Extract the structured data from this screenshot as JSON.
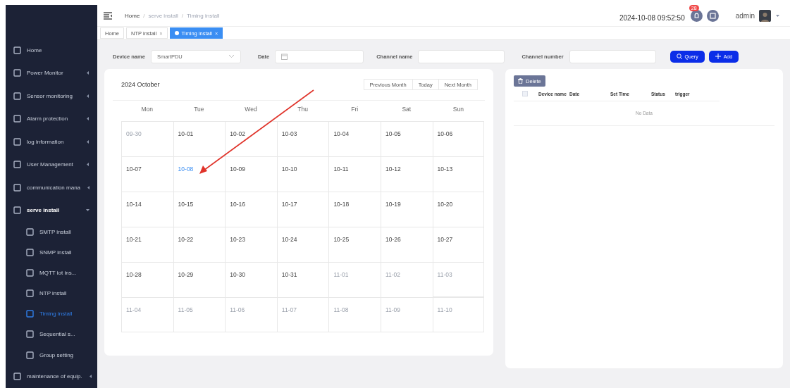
{
  "sidebar": {
    "items": [
      {
        "label": "Home",
        "expandable": false,
        "expanded": false
      },
      {
        "label": "Power Monitor",
        "expandable": true,
        "expanded": false
      },
      {
        "label": "Sensor monitoring",
        "expandable": true,
        "expanded": false
      },
      {
        "label": "Alarm protection",
        "expandable": true,
        "expanded": false
      },
      {
        "label": "log information",
        "expandable": true,
        "expanded": false
      },
      {
        "label": "User Management",
        "expandable": true,
        "expanded": false
      },
      {
        "label": "communication mana",
        "expandable": true,
        "expanded": false
      },
      {
        "label": "serve install",
        "expandable": true,
        "expanded": true,
        "children": [
          {
            "label": "SMTP install",
            "selected": false
          },
          {
            "label": "SNMP install",
            "selected": false
          },
          {
            "label": "MQTT iot ins...",
            "selected": false
          },
          {
            "label": "NTP install",
            "selected": false
          },
          {
            "label": "Timing install",
            "selected": true
          },
          {
            "label": "Sequential s...",
            "selected": false
          },
          {
            "label": "Group setting",
            "selected": false
          }
        ]
      },
      {
        "label": "maintenance of equip.",
        "expandable": true,
        "expanded": false
      }
    ]
  },
  "header": {
    "breadcrumb": [
      {
        "label": "Home"
      },
      {
        "separator": "/",
        "label": "serve install"
      },
      {
        "separator": "/",
        "label": "Timing install"
      }
    ],
    "datetime": "2024-10-08 09:52:50",
    "notification_count": "28",
    "user": "admin"
  },
  "tabs": [
    {
      "label": "Home",
      "selected": false
    },
    {
      "label": "NTP install",
      "selected": false,
      "close": "×"
    },
    {
      "label": "Timing install",
      "selected": true,
      "close": "×"
    }
  ],
  "filters": [
    {
      "label": "Device name",
      "kind": "select",
      "value": "SmartPDU"
    },
    {
      "label": "Date",
      "kind": "date"
    },
    {
      "label": "Channel name",
      "kind": "text"
    },
    {
      "label": "Channel number",
      "kind": "text"
    }
  ],
  "actions": [
    {
      "label": "Query",
      "kind": "search"
    },
    {
      "label": "Add",
      "kind": "add"
    }
  ],
  "calendar": {
    "title": "2024 October",
    "nav": [
      "Previous Month",
      "Today",
      "Next Month"
    ],
    "weekdays": [
      "Mon",
      "Tue",
      "Wed",
      "Thu",
      "Fri",
      "Sat",
      "Sun"
    ],
    "weeks": [
      {
        "days": [
          {
            "label": "09-30",
            "in_month": false,
            "today": false
          },
          {
            "label": "10-01",
            "in_month": true,
            "today": false
          },
          {
            "label": "10-02",
            "in_month": true,
            "today": false
          },
          {
            "label": "10-03",
            "in_month": true,
            "today": false
          },
          {
            "label": "10-04",
            "in_month": true,
            "today": false
          },
          {
            "label": "10-05",
            "in_month": true,
            "today": false
          },
          {
            "label": "10-06",
            "in_month": true,
            "today": false
          }
        ]
      },
      {
        "days": [
          {
            "label": "10-07",
            "in_month": true,
            "today": false
          },
          {
            "label": "10-08",
            "in_month": true,
            "today": true
          },
          {
            "label": "10-09",
            "in_month": true,
            "today": false
          },
          {
            "label": "10-10",
            "in_month": true,
            "today": false
          },
          {
            "label": "10-11",
            "in_month": true,
            "today": false
          },
          {
            "label": "10-12",
            "in_month": true,
            "today": false
          },
          {
            "label": "10-13",
            "in_month": true,
            "today": false
          }
        ]
      },
      {
        "days": [
          {
            "label": "10-14",
            "in_month": true,
            "today": false
          },
          {
            "label": "10-15",
            "in_month": true,
            "today": false
          },
          {
            "label": "10-16",
            "in_month": true,
            "today": false
          },
          {
            "label": "10-17",
            "in_month": true,
            "today": false
          },
          {
            "label": "10-18",
            "in_month": true,
            "today": false
          },
          {
            "label": "10-19",
            "in_month": true,
            "today": false
          },
          {
            "label": "10-20",
            "in_month": true,
            "today": false
          }
        ]
      },
      {
        "days": [
          {
            "label": "10-21",
            "in_month": true,
            "today": false
          },
          {
            "label": "10-22",
            "in_month": true,
            "today": false
          },
          {
            "label": "10-23",
            "in_month": true,
            "today": false
          },
          {
            "label": "10-24",
            "in_month": true,
            "today": false
          },
          {
            "label": "10-25",
            "in_month": true,
            "today": false
          },
          {
            "label": "10-26",
            "in_month": true,
            "today": false
          },
          {
            "label": "10-27",
            "in_month": true,
            "today": false
          }
        ]
      },
      {
        "days": [
          {
            "label": "10-28",
            "in_month": true,
            "today": false
          },
          {
            "label": "10-29",
            "in_month": true,
            "today": false
          },
          {
            "label": "10-30",
            "in_month": true,
            "today": false
          },
          {
            "label": "10-31",
            "in_month": true,
            "today": false
          },
          {
            "label": "11-01",
            "in_month": false,
            "today": false
          },
          {
            "label": "11-02",
            "in_month": false,
            "today": false
          },
          {
            "label": "11-03",
            "in_month": false,
            "today": false
          }
        ]
      },
      {
        "days": [
          {
            "label": "11-04",
            "in_month": false,
            "today": false
          },
          {
            "label": "11-05",
            "in_month": false,
            "today": false
          },
          {
            "label": "11-06",
            "in_month": false,
            "today": false
          },
          {
            "label": "11-07",
            "in_month": false,
            "today": false
          },
          {
            "label": "11-08",
            "in_month": false,
            "today": false
          },
          {
            "label": "11-09",
            "in_month": false,
            "today": false
          },
          {
            "label": "11-10",
            "in_month": false,
            "today": false
          }
        ]
      }
    ]
  },
  "table": {
    "delete_button": "Delete",
    "columns": [
      "Device name",
      "Date",
      "Set Time",
      "Status",
      "trigger"
    ],
    "select_all": {
      "checked": false
    },
    "empty_text": "No Data"
  }
}
